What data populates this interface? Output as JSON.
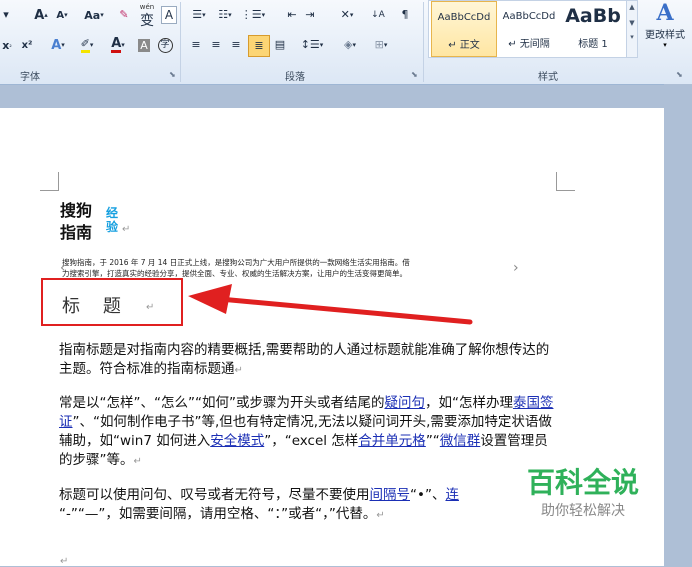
{
  "ribbon": {
    "font_group_label": "字体",
    "paragraph_group_label": "段落",
    "styles_group_label": "样式",
    "change_styles_label": "更改样式",
    "font_buttons": {
      "grow_font": "A",
      "shrink_font": "A",
      "change_case": "Aa",
      "phonetic_guide": "wén",
      "char_border": "A",
      "subscript": "x",
      "superscript": "x²",
      "text_effect": "A",
      "font_color": "A",
      "char_shading": "A",
      "enclose": "字"
    },
    "styles": [
      {
        "sample": "AaBbCcDd",
        "name": "↵ 正文",
        "selected": true
      },
      {
        "sample": "AaBbCcDd",
        "name": "↵ 无间隔",
        "selected": false
      },
      {
        "sample": "AaBb",
        "name": "标题 1",
        "selected": false
      }
    ]
  },
  "document": {
    "logo_line1": "搜狗",
    "logo_line2": "指南",
    "logo_accent": "经验",
    "intro_line1": "搜狗指南，于 2016 年 7 月 14 日正式上线，是搜狗公司为广大用户所提供的一款网络生活实用指南。借",
    "intro_line2": "力搜索引擎，打造真实的经验分享，提供全面、专业、权威的生活解决方案，让用户的生活变得更简单。",
    "heading": "标    题",
    "p1": "指南标题是对指南内容的精要概括,需要帮助的人通过标题就能准确了解你想传达的主题。符合标准的指南标题通",
    "p2_a": "常是以“怎样”、“怎么”“如何”或步骤为开头或者结尾的",
    "p2_link1": "疑问句",
    "p2_b": "，如“怎样办理",
    "p2_link2": "泰国签证",
    "p2_c": "”、“如何制作电子书”等,但也有特定情况,无法以疑问词开头,需要添加特定状语做辅助，如“win7 如何进入",
    "p2_link3": "安全模式",
    "p2_d": "”，“excel 怎样",
    "p2_link4": "合并单元格",
    "p2_e": "”“",
    "p2_link5": "微信群",
    "p2_f": "设置管理员的步骤”等。",
    "p3_a": "标题可以使用问句、叹号或者无符号，尽量不要使用",
    "p3_link1": "间隔号",
    "p3_b": "“•”、",
    "p3_link2": "连",
    "p3_c": "“-”“—”，如需要间隔，请用空格、“：”或者“，”代替。"
  },
  "watermark": {
    "title": "百科全说",
    "subtitle": "助你轻松解决"
  },
  "colors": {
    "annotation_red": "#e02020",
    "watermark_green": "#2fb15a",
    "logo_accent_blue": "#16a0e0",
    "link_blue": "#1b2fb5"
  }
}
